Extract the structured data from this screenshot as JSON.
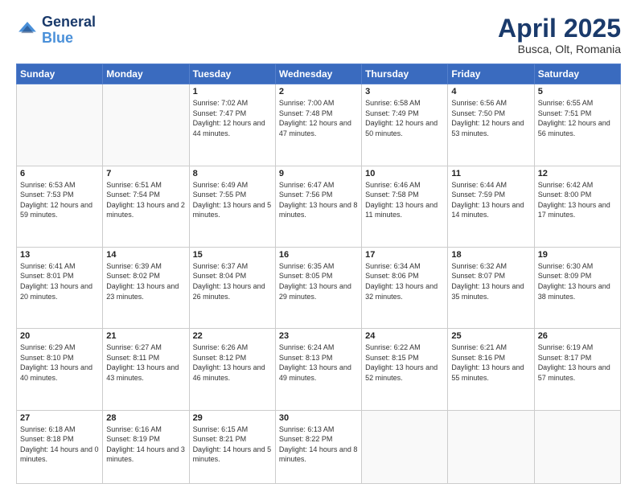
{
  "logo": {
    "line1": "General",
    "line2": "Blue"
  },
  "title": "April 2025",
  "subtitle": "Busca, Olt, Romania",
  "header_days": [
    "Sunday",
    "Monday",
    "Tuesday",
    "Wednesday",
    "Thursday",
    "Friday",
    "Saturday"
  ],
  "weeks": [
    [
      {
        "day": "",
        "sunrise": "",
        "sunset": "",
        "daylight": ""
      },
      {
        "day": "",
        "sunrise": "",
        "sunset": "",
        "daylight": ""
      },
      {
        "day": "1",
        "sunrise": "Sunrise: 7:02 AM",
        "sunset": "Sunset: 7:47 PM",
        "daylight": "Daylight: 12 hours and 44 minutes."
      },
      {
        "day": "2",
        "sunrise": "Sunrise: 7:00 AM",
        "sunset": "Sunset: 7:48 PM",
        "daylight": "Daylight: 12 hours and 47 minutes."
      },
      {
        "day": "3",
        "sunrise": "Sunrise: 6:58 AM",
        "sunset": "Sunset: 7:49 PM",
        "daylight": "Daylight: 12 hours and 50 minutes."
      },
      {
        "day": "4",
        "sunrise": "Sunrise: 6:56 AM",
        "sunset": "Sunset: 7:50 PM",
        "daylight": "Daylight: 12 hours and 53 minutes."
      },
      {
        "day": "5",
        "sunrise": "Sunrise: 6:55 AM",
        "sunset": "Sunset: 7:51 PM",
        "daylight": "Daylight: 12 hours and 56 minutes."
      }
    ],
    [
      {
        "day": "6",
        "sunrise": "Sunrise: 6:53 AM",
        "sunset": "Sunset: 7:53 PM",
        "daylight": "Daylight: 12 hours and 59 minutes."
      },
      {
        "day": "7",
        "sunrise": "Sunrise: 6:51 AM",
        "sunset": "Sunset: 7:54 PM",
        "daylight": "Daylight: 13 hours and 2 minutes."
      },
      {
        "day": "8",
        "sunrise": "Sunrise: 6:49 AM",
        "sunset": "Sunset: 7:55 PM",
        "daylight": "Daylight: 13 hours and 5 minutes."
      },
      {
        "day": "9",
        "sunrise": "Sunrise: 6:47 AM",
        "sunset": "Sunset: 7:56 PM",
        "daylight": "Daylight: 13 hours and 8 minutes."
      },
      {
        "day": "10",
        "sunrise": "Sunrise: 6:46 AM",
        "sunset": "Sunset: 7:58 PM",
        "daylight": "Daylight: 13 hours and 11 minutes."
      },
      {
        "day": "11",
        "sunrise": "Sunrise: 6:44 AM",
        "sunset": "Sunset: 7:59 PM",
        "daylight": "Daylight: 13 hours and 14 minutes."
      },
      {
        "day": "12",
        "sunrise": "Sunrise: 6:42 AM",
        "sunset": "Sunset: 8:00 PM",
        "daylight": "Daylight: 13 hours and 17 minutes."
      }
    ],
    [
      {
        "day": "13",
        "sunrise": "Sunrise: 6:41 AM",
        "sunset": "Sunset: 8:01 PM",
        "daylight": "Daylight: 13 hours and 20 minutes."
      },
      {
        "day": "14",
        "sunrise": "Sunrise: 6:39 AM",
        "sunset": "Sunset: 8:02 PM",
        "daylight": "Daylight: 13 hours and 23 minutes."
      },
      {
        "day": "15",
        "sunrise": "Sunrise: 6:37 AM",
        "sunset": "Sunset: 8:04 PM",
        "daylight": "Daylight: 13 hours and 26 minutes."
      },
      {
        "day": "16",
        "sunrise": "Sunrise: 6:35 AM",
        "sunset": "Sunset: 8:05 PM",
        "daylight": "Daylight: 13 hours and 29 minutes."
      },
      {
        "day": "17",
        "sunrise": "Sunrise: 6:34 AM",
        "sunset": "Sunset: 8:06 PM",
        "daylight": "Daylight: 13 hours and 32 minutes."
      },
      {
        "day": "18",
        "sunrise": "Sunrise: 6:32 AM",
        "sunset": "Sunset: 8:07 PM",
        "daylight": "Daylight: 13 hours and 35 minutes."
      },
      {
        "day": "19",
        "sunrise": "Sunrise: 6:30 AM",
        "sunset": "Sunset: 8:09 PM",
        "daylight": "Daylight: 13 hours and 38 minutes."
      }
    ],
    [
      {
        "day": "20",
        "sunrise": "Sunrise: 6:29 AM",
        "sunset": "Sunset: 8:10 PM",
        "daylight": "Daylight: 13 hours and 40 minutes."
      },
      {
        "day": "21",
        "sunrise": "Sunrise: 6:27 AM",
        "sunset": "Sunset: 8:11 PM",
        "daylight": "Daylight: 13 hours and 43 minutes."
      },
      {
        "day": "22",
        "sunrise": "Sunrise: 6:26 AM",
        "sunset": "Sunset: 8:12 PM",
        "daylight": "Daylight: 13 hours and 46 minutes."
      },
      {
        "day": "23",
        "sunrise": "Sunrise: 6:24 AM",
        "sunset": "Sunset: 8:13 PM",
        "daylight": "Daylight: 13 hours and 49 minutes."
      },
      {
        "day": "24",
        "sunrise": "Sunrise: 6:22 AM",
        "sunset": "Sunset: 8:15 PM",
        "daylight": "Daylight: 13 hours and 52 minutes."
      },
      {
        "day": "25",
        "sunrise": "Sunrise: 6:21 AM",
        "sunset": "Sunset: 8:16 PM",
        "daylight": "Daylight: 13 hours and 55 minutes."
      },
      {
        "day": "26",
        "sunrise": "Sunrise: 6:19 AM",
        "sunset": "Sunset: 8:17 PM",
        "daylight": "Daylight: 13 hours and 57 minutes."
      }
    ],
    [
      {
        "day": "27",
        "sunrise": "Sunrise: 6:18 AM",
        "sunset": "Sunset: 8:18 PM",
        "daylight": "Daylight: 14 hours and 0 minutes."
      },
      {
        "day": "28",
        "sunrise": "Sunrise: 6:16 AM",
        "sunset": "Sunset: 8:19 PM",
        "daylight": "Daylight: 14 hours and 3 minutes."
      },
      {
        "day": "29",
        "sunrise": "Sunrise: 6:15 AM",
        "sunset": "Sunset: 8:21 PM",
        "daylight": "Daylight: 14 hours and 5 minutes."
      },
      {
        "day": "30",
        "sunrise": "Sunrise: 6:13 AM",
        "sunset": "Sunset: 8:22 PM",
        "daylight": "Daylight: 14 hours and 8 minutes."
      },
      {
        "day": "",
        "sunrise": "",
        "sunset": "",
        "daylight": ""
      },
      {
        "day": "",
        "sunrise": "",
        "sunset": "",
        "daylight": ""
      },
      {
        "day": "",
        "sunrise": "",
        "sunset": "",
        "daylight": ""
      }
    ]
  ]
}
